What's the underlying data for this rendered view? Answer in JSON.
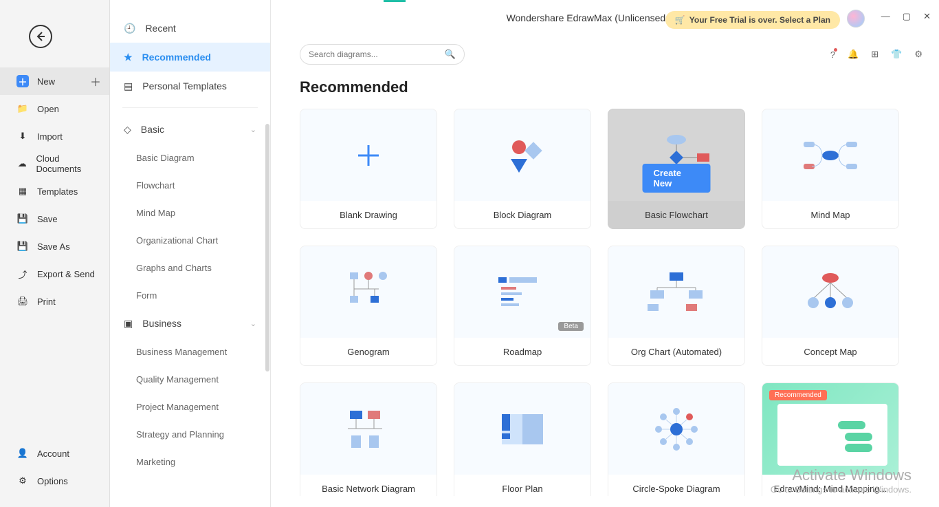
{
  "app": {
    "title": "Wondershare EdrawMax (Unlicensed Version)",
    "trial_notice": "Your Free Trial is over. Select a Plan"
  },
  "rail": {
    "new": "New",
    "open": "Open",
    "import": "Import",
    "cloud_documents": "Cloud Documents",
    "templates": "Templates",
    "save": "Save",
    "save_as": "Save As",
    "export_send": "Export & Send",
    "print": "Print",
    "account": "Account",
    "options": "Options"
  },
  "side": {
    "recent": "Recent",
    "recommended": "Recommended",
    "personal_templates": "Personal Templates",
    "categories": [
      {
        "name": "Basic",
        "items": [
          "Basic Diagram",
          "Flowchart",
          "Mind Map",
          "Organizational Chart",
          "Graphs and Charts",
          "Form"
        ]
      },
      {
        "name": "Business",
        "items": [
          "Business Management",
          "Quality Management",
          "Project Management",
          "Strategy and Planning",
          "Marketing"
        ]
      }
    ]
  },
  "search": {
    "placeholder": "Search diagrams..."
  },
  "section_title": "Recommended",
  "cards": [
    {
      "label": "Blank Drawing"
    },
    {
      "label": "Block Diagram"
    },
    {
      "label": "Basic Flowchart",
      "hover": true,
      "create_label": "Create New"
    },
    {
      "label": "Mind Map"
    },
    {
      "label": "Genogram"
    },
    {
      "label": "Roadmap",
      "beta": "Beta"
    },
    {
      "label": "Org Chart (Automated)"
    },
    {
      "label": "Concept Map"
    },
    {
      "label": "Basic Network Diagram"
    },
    {
      "label": "Floor Plan"
    },
    {
      "label": "Circle-Spoke Diagram"
    },
    {
      "label": "EdrawMind: Mind Mapping...",
      "recommended_badge": "Recommended"
    }
  ],
  "watermark": {
    "line1": "Activate Windows",
    "line2": "Go to Settings to activate Windows."
  }
}
